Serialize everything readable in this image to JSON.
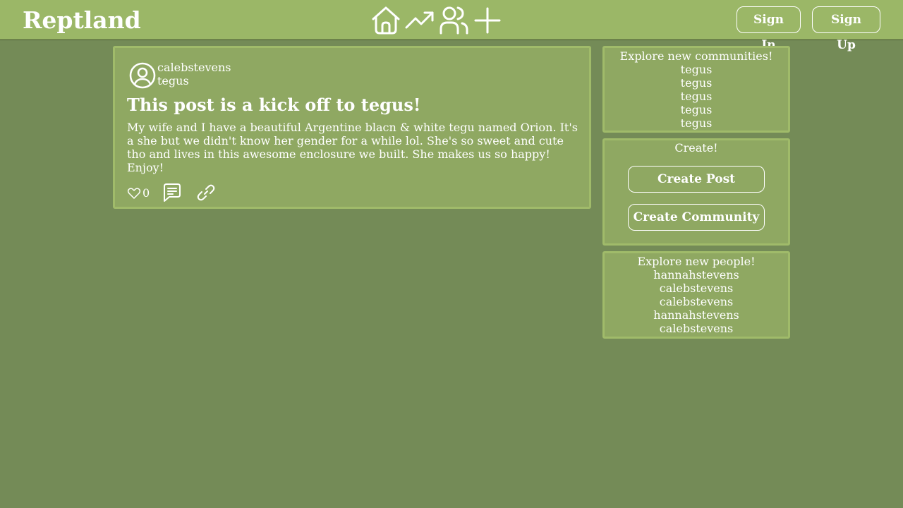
{
  "header": {
    "brand": "Reptland",
    "nav_icons": [
      "home-icon",
      "trending-icon",
      "people-icon",
      "plus-icon"
    ],
    "sign_in_label": "Sign In",
    "sign_up_label": "Sign Up"
  },
  "post": {
    "author": "calebstevens",
    "community": "tegus",
    "title": "This post is a kick off to tegus!",
    "body": "My wife and I have a beautiful Argentine blacn & white tegu named Orion. It's a she but we didn't know her gender for a while lol. She's so sweet and cute tho and lives in this awesome enclosure we built. She makes us so happy! Enjoy!",
    "like_count": "0",
    "icons": [
      "avatar-icon",
      "heart-icon",
      "comment-icon",
      "link-icon"
    ]
  },
  "sidebar": {
    "communities": {
      "heading": "Explore new communities!",
      "items": [
        "tegus",
        "tegus",
        "tegus",
        "tegus",
        "tegus"
      ]
    },
    "create": {
      "heading": "Create!",
      "post_label": "Create Post",
      "community_label": "Create Community"
    },
    "people": {
      "heading": "Explore new people!",
      "items": [
        "hannahstevens",
        "calebstevens",
        "calebstevens",
        "hannahstevens",
        "calebstevens"
      ]
    }
  },
  "colors": {
    "page_background": "#748b57",
    "header_background": "#9bb767",
    "card_background": "#8fa862",
    "card_border": "#a0bb6a",
    "text": "#ffffff"
  }
}
